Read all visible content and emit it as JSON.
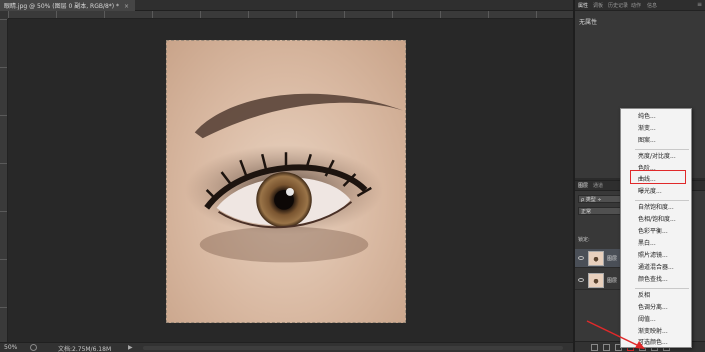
{
  "document": {
    "tab_title": "眼睛.jpg @ 50% (图层 0 副本, RGB/8*) *",
    "tab_close": "×"
  },
  "status": {
    "zoom": "50%",
    "doc_size": "文档:2.75M/6.18M",
    "arrow": "▶"
  },
  "properties_panel": {
    "tabs": [
      "属性",
      "调板",
      "历史记录",
      "动作",
      "信息"
    ],
    "menu_icon": "≡",
    "empty_text": "无属性"
  },
  "layers_panel": {
    "tabs": [
      "图层",
      "通道"
    ],
    "kind_filter": "ρ 类型 ÷",
    "blend_mode": "正常",
    "lock_label": "锁定:",
    "layers": [
      {
        "name": "图层"
      },
      {
        "name": "图层"
      }
    ]
  },
  "adjustment_menu": {
    "items": [
      "纯色...",
      "渐变...",
      "图案...",
      "亮度/对比度...",
      "色阶...",
      "曲线...",
      "曝光度...",
      "自然饱和度...",
      "色相/饱和度...",
      "色彩平衡...",
      "黑白...",
      "照片滤镜...",
      "通道混合器...",
      "颜色查找...",
      "反相",
      "色调分离...",
      "阈值...",
      "渐变映射...",
      "可选颜色..."
    ],
    "highlighted_item": "曲线..."
  },
  "colors": {
    "highlight_box": "#e0292a",
    "workspace_bg": "#282828",
    "panel_bg": "#383838"
  }
}
